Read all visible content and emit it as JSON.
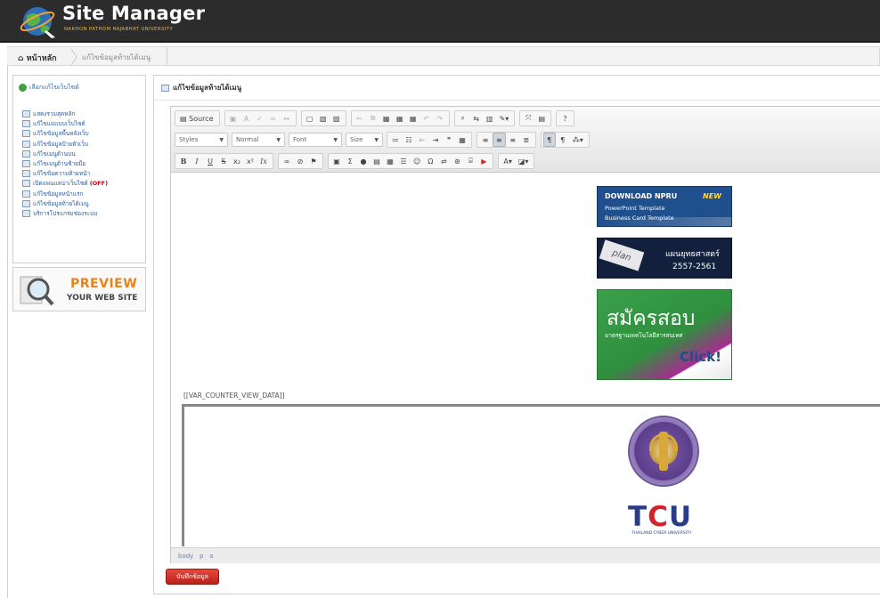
{
  "header": {
    "title": "Site Manager",
    "subtitle": "NAKHON PATHOM RAJABHAT UNIVERSITY"
  },
  "breadcrumb": {
    "home": "หน้าหลัก",
    "current": "แก้ไขข้อมูลท้ายได้เมนู"
  },
  "sidebar": {
    "heading": "เลือกแก้ไขเว็บไซต์",
    "items": [
      {
        "label": "แสดงรวมสุดหลัก"
      },
      {
        "label": "แก้ไขแม่แบบเว็บไซต์"
      },
      {
        "label": "แก้ไขข้อมูลพื้นหลังเว็บ"
      },
      {
        "label": "แก้ไขข้อมูลป้ายหัวเว็บ"
      },
      {
        "label": "แก้ไขเมนูด้านบน"
      },
      {
        "label": "แก้ไขเมนูด้านซ้ายมือ"
      },
      {
        "label": "แก้ไขข้อความท้ายหน้า"
      },
      {
        "label": "เปิดแพนแลน่าเว็บไซต์",
        "badge": "(OFF)"
      },
      {
        "label": "แก้ไขข้อมูลหน้าแรก"
      },
      {
        "label": "แก้ไขข้อมูลท้ายได้เมนู"
      },
      {
        "label": "บริการโปรแกรมช่องระบบ"
      }
    ],
    "preview_line1": "PREVIEW",
    "preview_line2": "YOUR WEB SITE"
  },
  "main": {
    "title": "แก้ไขข้อมูลท้ายได้เมนู"
  },
  "editor": {
    "source_label": "Source",
    "styles_label": "Styles",
    "format_label": "Normal",
    "font_label": "Font",
    "size_label": "Size",
    "path": [
      "body",
      "p",
      "a"
    ]
  },
  "content": {
    "npru_title": "DOWNLOAD NPRU",
    "npru_new": "NEW",
    "npru_line2": "PowerPoint Template",
    "npru_line3": "Business Card Template",
    "plan_tag": "plan",
    "plan_line1": "แผนยุทธศาสตร์",
    "plan_line2": "2557-2561",
    "apply_title": "สมัครสอบ",
    "apply_sub": "มาตรฐานเทคโนโลยีสารสนเทศ",
    "apply_click": "Click!",
    "counter_tag": "[[VAR_COUNTER_VIEW_DATA]]",
    "tcu_t": "T",
    "tcu_c": "C",
    "tcu_u": "U",
    "tcu_sub": "THAILAND CYBER UNIVERSITY"
  },
  "actions": {
    "save_label": "บันทึกข้อมูล"
  },
  "colors": {
    "header_bg": "#2c2c2c",
    "accent_orange": "#e8821c",
    "save_red": "#c8291f",
    "link_blue": "#2d5c9a",
    "off_red": "#d0021b"
  },
  "icons": [
    "globe-logo-icon",
    "home-icon",
    "sidebar-item-icon",
    "magnifier-icon",
    "page-icon"
  ]
}
